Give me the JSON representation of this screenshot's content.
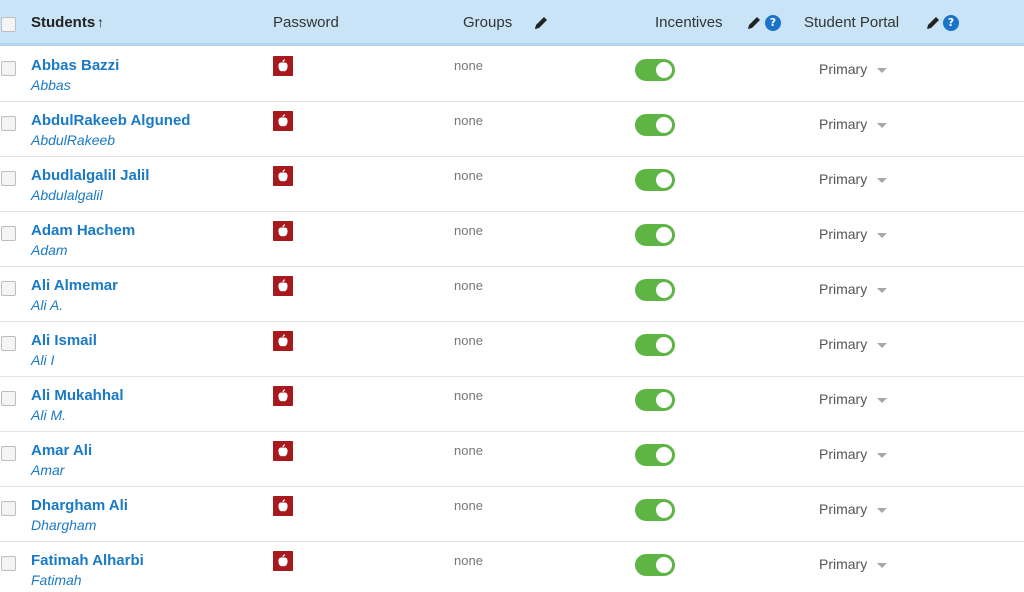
{
  "header": {
    "students_label": "Students",
    "sort_arrow": "↑",
    "password_label": "Password",
    "groups_label": "Groups",
    "incentives_label": "Incentives",
    "portal_label": "Student Portal",
    "help_glyph": "?"
  },
  "rows": [
    {
      "name": "Abbas Bazzi",
      "nickname": "Abbas",
      "groups": "none",
      "incentives_on": true,
      "portal": "Primary"
    },
    {
      "name": "AbdulRakeeb Alguned",
      "nickname": "AbdulRakeeb",
      "groups": "none",
      "incentives_on": true,
      "portal": "Primary"
    },
    {
      "name": "Abudlalgalil Jalil",
      "nickname": "Abdulalgalil",
      "groups": "none",
      "incentives_on": true,
      "portal": "Primary"
    },
    {
      "name": "Adam Hachem",
      "nickname": "Adam",
      "groups": "none",
      "incentives_on": true,
      "portal": "Primary"
    },
    {
      "name": "Ali Almemar",
      "nickname": "Ali A.",
      "groups": "none",
      "incentives_on": true,
      "portal": "Primary"
    },
    {
      "name": "Ali Ismail",
      "nickname": "Ali I",
      "groups": "none",
      "incentives_on": true,
      "portal": "Primary"
    },
    {
      "name": "Ali Mukahhal",
      "nickname": "Ali M.",
      "groups": "none",
      "incentives_on": true,
      "portal": "Primary"
    },
    {
      "name": "Amar Ali",
      "nickname": "Amar",
      "groups": "none",
      "incentives_on": true,
      "portal": "Primary"
    },
    {
      "name": "Dhargham Ali",
      "nickname": "Dhargham",
      "groups": "none",
      "incentives_on": true,
      "portal": "Primary"
    },
    {
      "name": "Fatimah Alharbi",
      "nickname": "Fatimah",
      "groups": "none",
      "incentives_on": true,
      "portal": "Primary"
    }
  ],
  "colors": {
    "header_bg": "#c9e4f6",
    "name_link": "#1a7ac6",
    "password_icon": "#a8191e",
    "toggle_on": "#5fb544",
    "help_icon": "#1a73c8"
  },
  "icons": {
    "password": "apple-icon",
    "edit": "pencil-icon",
    "help": "help-icon",
    "sort": "arrow-up-icon",
    "dropdown": "caret-down-icon"
  }
}
